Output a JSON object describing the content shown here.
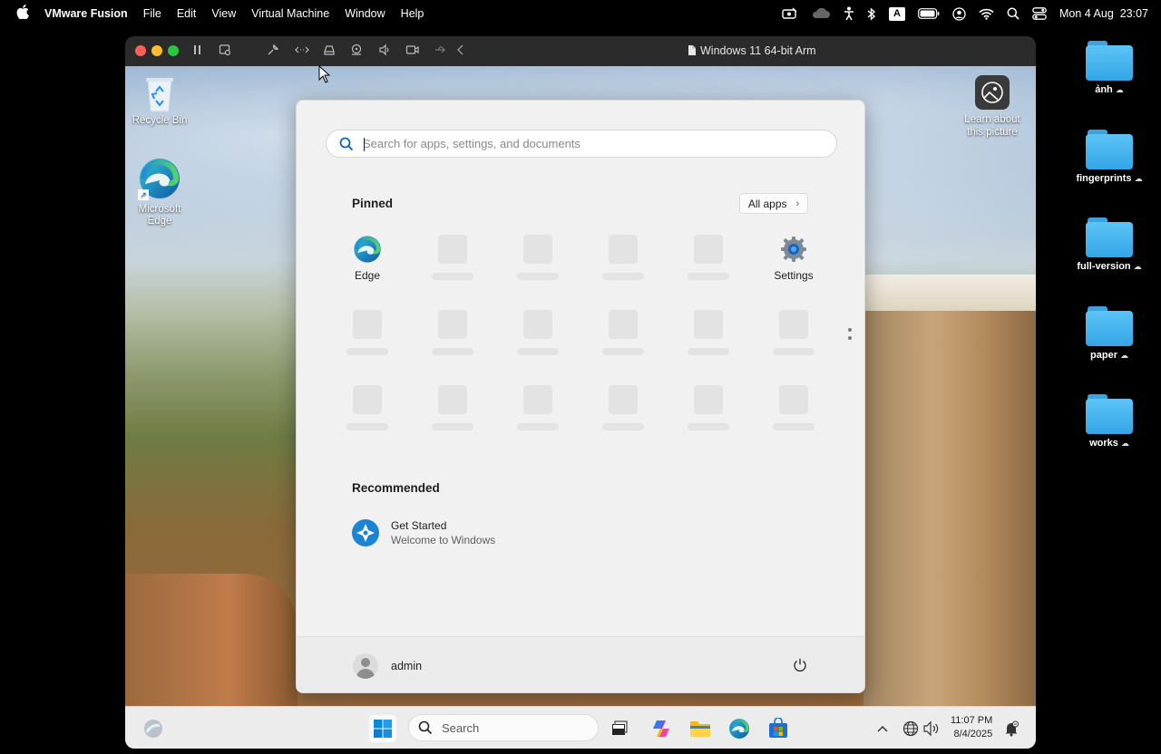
{
  "mac_menubar": {
    "app_name": "VMware Fusion",
    "menus": [
      "File",
      "Edit",
      "View",
      "Virtual Machine",
      "Window",
      "Help"
    ],
    "input_source": "A",
    "clock": "Mon 4 Aug  23:07"
  },
  "mac_desktop": {
    "folders": [
      {
        "label": "ảnh"
      },
      {
        "label": "fingerprints"
      },
      {
        "label": "full-version"
      },
      {
        "label": "paper"
      },
      {
        "label": "works"
      }
    ]
  },
  "vm_window": {
    "title": "Windows 11 64-bit Arm"
  },
  "win_desktop": {
    "icons": [
      {
        "label": "Recycle Bin"
      },
      {
        "label": "Microsoft Edge"
      },
      {
        "label": "Learn about this picture"
      }
    ]
  },
  "start_menu": {
    "search_placeholder": "Search for apps, settings, and documents",
    "pinned_title": "Pinned",
    "all_apps_label": "All apps",
    "pinned_apps": [
      {
        "label": "Edge"
      },
      {
        "label": "Settings"
      }
    ],
    "recommended_title": "Recommended",
    "recommended": [
      {
        "title": "Get Started",
        "subtitle": "Welcome to Windows"
      }
    ],
    "user_name": "admin"
  },
  "taskbar": {
    "search_label": "Search",
    "time": "11:07 PM",
    "date": "8/4/2025"
  },
  "colors": {
    "accent": "#0078d4",
    "mac_folder": "#45b4ee",
    "taskbar_bg": "#ececec",
    "start_bg": "#f1f1f1"
  }
}
